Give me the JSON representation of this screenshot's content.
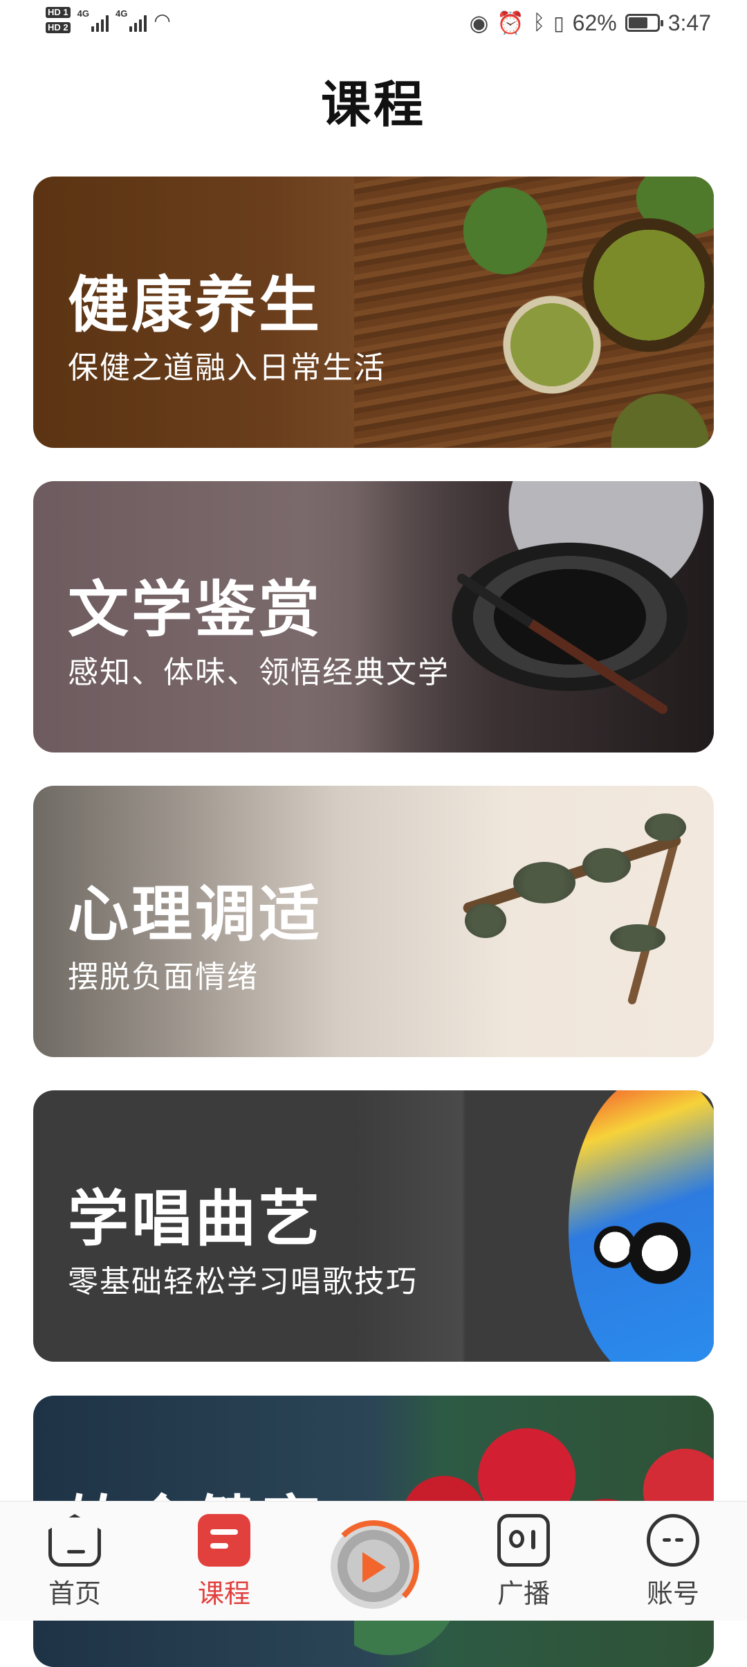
{
  "status_bar": {
    "sim1": "HD 1",
    "sim2": "HD 2",
    "net1": "4G",
    "net2": "4G",
    "battery": "62%",
    "battery_level": 0.62,
    "time": "3:47"
  },
  "header": {
    "title": "课程"
  },
  "cards": [
    {
      "title": "健康养生",
      "subtitle": "保健之道融入日常生活"
    },
    {
      "title": "文学鉴赏",
      "subtitle": "感知、体味、领悟经典文学"
    },
    {
      "title": "心理调适",
      "subtitle": "摆脱负面情绪"
    },
    {
      "title": "学唱曲艺",
      "subtitle": "零基础轻松学习唱歌技巧"
    },
    {
      "title": "饮食健康",
      "subtitle": ""
    }
  ],
  "bottom_nav": {
    "items": [
      {
        "label": "首页",
        "icon": "home-icon"
      },
      {
        "label": "课程",
        "icon": "course-icon",
        "active": true
      },
      {
        "label": "",
        "icon": "player-icon"
      },
      {
        "label": "广播",
        "icon": "radio-icon"
      },
      {
        "label": "账号",
        "icon": "account-icon"
      }
    ]
  },
  "colors": {
    "accent": "#e2403d",
    "player": "#f2662d"
  }
}
